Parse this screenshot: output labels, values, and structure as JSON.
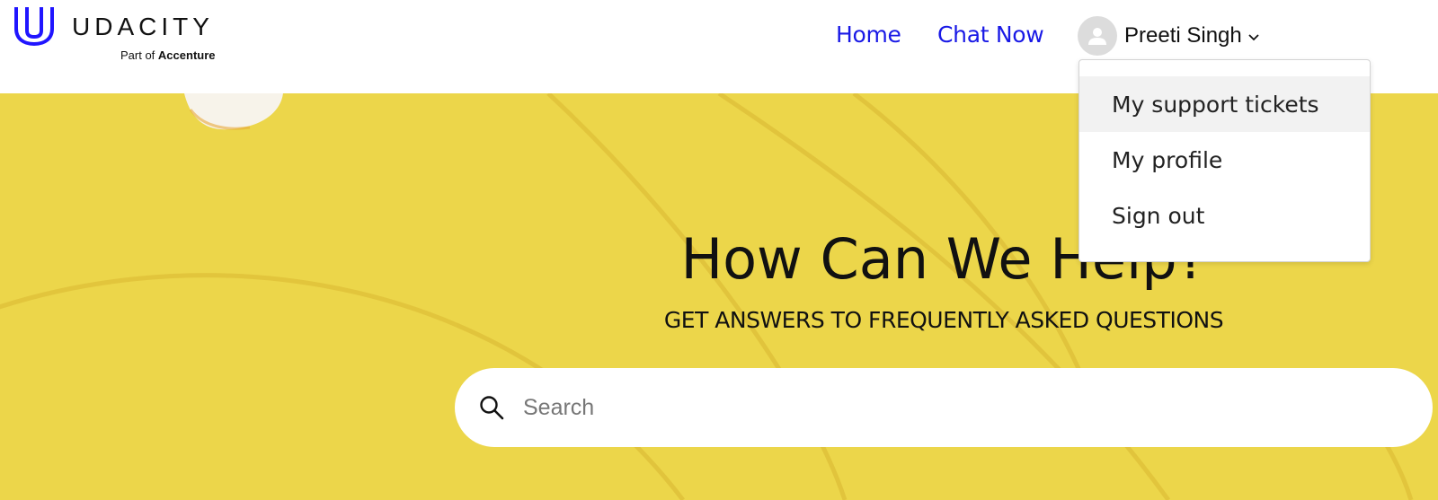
{
  "brand": {
    "name": "UDACITY",
    "tagline_prefix": "Part of",
    "tagline_company": "Accenture",
    "color": "#2015FF"
  },
  "nav": {
    "home": "Home",
    "chat": "Chat Now",
    "link_color": "#1919E6"
  },
  "user": {
    "name": "Preeti Singh",
    "avatar_icon": "user-silhouette-icon",
    "menu_icon": "chevron-down-icon"
  },
  "dropdown": {
    "items": [
      {
        "label": "My support tickets",
        "active": true
      },
      {
        "label": "My profile",
        "active": false
      },
      {
        "label": "Sign out",
        "active": false
      }
    ]
  },
  "hero": {
    "title": "How Can We Help?",
    "subtitle": "GET ANSWERS TO FREQUENTLY ASKED QUESTIONS",
    "background_color": "#ECD64A"
  },
  "search": {
    "placeholder": "Search",
    "value": "",
    "icon": "search-icon"
  }
}
